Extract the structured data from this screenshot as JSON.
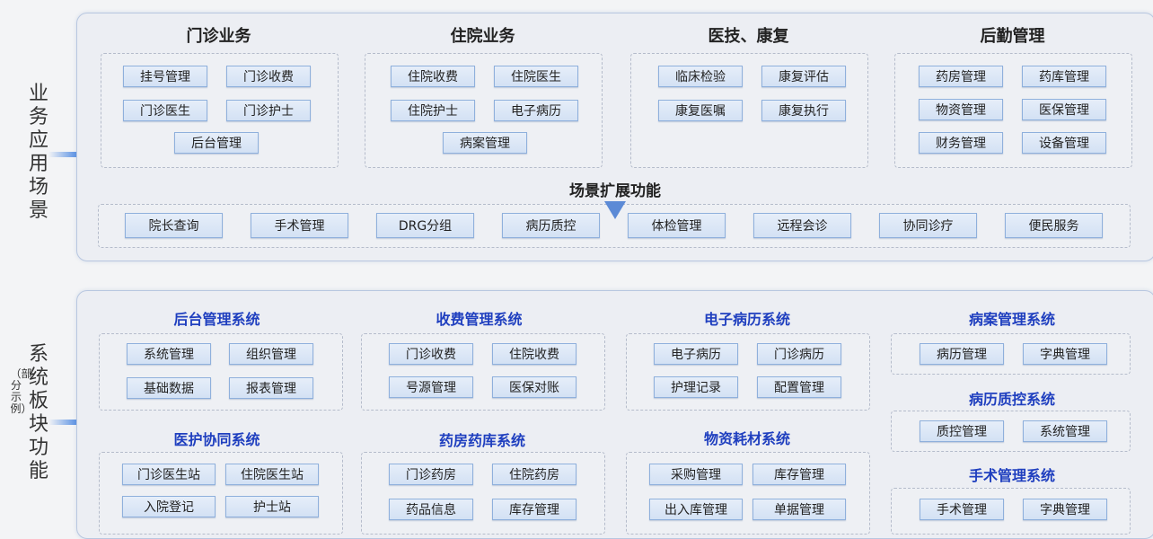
{
  "labels": {
    "top": [
      "业",
      "务",
      "应",
      "用",
      "场",
      "景"
    ],
    "bottom_main_1": [
      "系",
      "统",
      "板"
    ],
    "bottom_sub": "（部分示例）",
    "bottom_main_2": [
      "块",
      "功",
      "能"
    ]
  },
  "top_groups": [
    {
      "title": "门诊业务",
      "items": [
        "挂号管理",
        "门诊收费",
        "门诊医生",
        "门诊护士",
        "后台管理"
      ]
    },
    {
      "title": "住院业务",
      "items": [
        "住院收费",
        "住院医生",
        "住院护士",
        "电子病历",
        "病案管理"
      ]
    },
    {
      "title": "医技、康复",
      "items": [
        "临床检验",
        "康复评估",
        "康复医嘱",
        "康复执行"
      ]
    },
    {
      "title": "后勤管理",
      "items": [
        "药房管理",
        "药库管理",
        "物资管理",
        "医保管理",
        "财务管理",
        "设备管理"
      ]
    }
  ],
  "extension": {
    "title": "场景扩展功能",
    "items": [
      "院长查询",
      "手术管理",
      "DRG分组",
      "病历质控",
      "体检管理",
      "远程会诊",
      "协同诊疗",
      "便民服务"
    ]
  },
  "systems": [
    {
      "title": "后台管理系统",
      "items": [
        "系统管理",
        "组织管理",
        "基础数据",
        "报表管理"
      ]
    },
    {
      "title": "收费管理系统",
      "items": [
        "门诊收费",
        "住院收费",
        "号源管理",
        "医保对账"
      ]
    },
    {
      "title": "电子病历系统",
      "items": [
        "电子病历",
        "门诊病历",
        "护理记录",
        "配置管理"
      ]
    },
    {
      "title": "病案管理系统",
      "items": [
        "病历管理",
        "字典管理"
      ]
    },
    {
      "title": "病历质控系统",
      "items": [
        "质控管理",
        "系统管理"
      ]
    },
    {
      "title": "医护协同系统",
      "items": [
        "门诊医生站",
        "住院医生站",
        "入院登记",
        "护士站"
      ]
    },
    {
      "title": "药房药库系统",
      "items": [
        "门诊药房",
        "住院药房",
        "药品信息",
        "库存管理"
      ]
    },
    {
      "title": "物资耗材系统",
      "items": [
        "采购管理",
        "库存管理",
        "出入库管理",
        "单据管理"
      ]
    },
    {
      "title": "手术管理系统",
      "items": [
        "手术管理",
        "字典管理"
      ]
    }
  ],
  "colors": {
    "accent": "#1f3fbf",
    "arrow": "#3b7de0",
    "chip_border": "#8fb0dc"
  }
}
